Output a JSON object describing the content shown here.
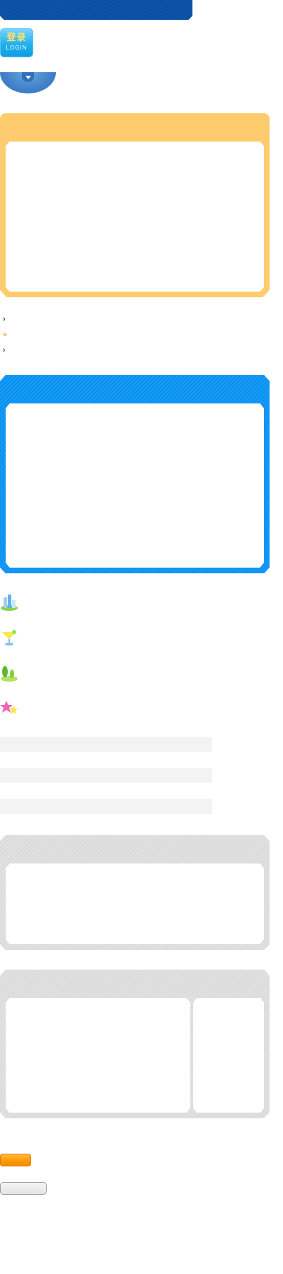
{
  "login": {
    "label_cn": "登录",
    "label_en": "LOGIN"
  },
  "icons": {
    "banner": "banner-decoration",
    "dropdown": "chevron-down-icon",
    "arrows": [
      "chevron-right-icon",
      "double-chevron-right-icon",
      "chevron-right-icon"
    ],
    "decorations": [
      "buildings-icon",
      "cocktail-icon",
      "trees-icon",
      "stars-icon"
    ]
  },
  "colors": {
    "banner": "#0e58b0",
    "login_button": "#1fb0ef",
    "orange_panel": "#fecc6f",
    "blue_panel": "#1a9df8",
    "gray_panel": "#dedede",
    "orange_button": "#ff9c0a",
    "gray_button": "#e8e8e8"
  }
}
